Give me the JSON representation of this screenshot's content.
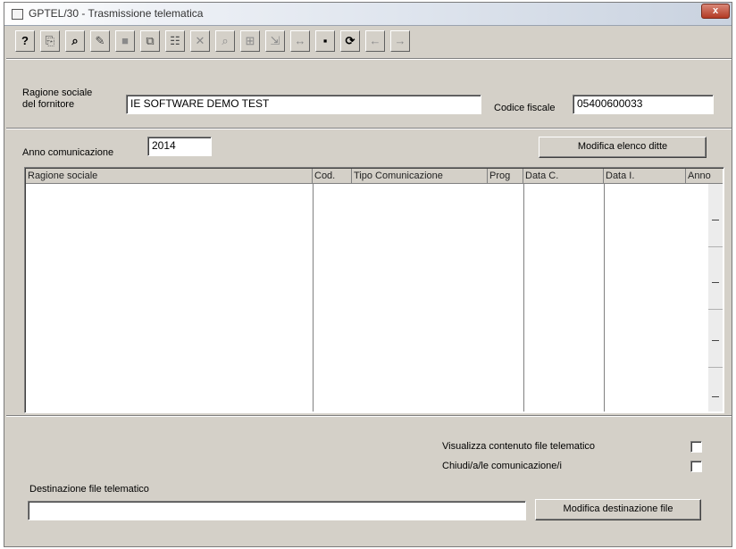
{
  "window": {
    "title": "GPTEL/30 - Trasmissione telematica",
    "close_label": "x"
  },
  "toolbar": {
    "buttons": [
      {
        "name": "help",
        "glyph": "?"
      },
      {
        "name": "new",
        "glyph": "⎘"
      },
      {
        "name": "find",
        "glyph": "⌕"
      },
      {
        "name": "edit",
        "glyph": "✎"
      },
      {
        "name": "stop",
        "glyph": "■"
      },
      {
        "name": "copy",
        "glyph": "⧉"
      },
      {
        "name": "list",
        "glyph": "☷"
      },
      {
        "name": "delete",
        "glyph": "✕"
      },
      {
        "name": "preview",
        "glyph": "⌕"
      },
      {
        "name": "filter",
        "glyph": "⊞"
      },
      {
        "name": "export",
        "glyph": "⇲"
      },
      {
        "name": "range",
        "glyph": "↔"
      },
      {
        "name": "save",
        "glyph": "▪"
      },
      {
        "name": "refresh",
        "glyph": "⟳"
      },
      {
        "name": "previous",
        "glyph": "←"
      },
      {
        "name": "next",
        "glyph": "→"
      }
    ]
  },
  "form": {
    "ragione_sociale_label_1": "Ragione sociale",
    "ragione_sociale_label_2": "del fornitore",
    "ragione_sociale_value": "IE SOFTWARE DEMO TEST",
    "codice_fiscale_label": "Codice fiscale",
    "codice_fiscale_value": "05400600033",
    "anno_label": "Anno comunicazione",
    "anno_value": "2014",
    "modifica_elenco_button": "Modifica elenco ditte"
  },
  "grid": {
    "columns": [
      "Ragione sociale",
      "Cod.",
      "Tipo Comunicazione",
      "Prog",
      "Data C.",
      "Data I.",
      "Anno"
    ],
    "rows": []
  },
  "footer": {
    "visualizza_label": "Visualizza contenuto file telematico",
    "visualizza_checked": false,
    "chiudi_label": "Chiudi/a/le comunicazione/i",
    "chiudi_checked": false,
    "destinazione_label": "Destinazione file telematico",
    "destinazione_value": "",
    "modifica_destinazione_button": "Modifica destinazione file"
  }
}
